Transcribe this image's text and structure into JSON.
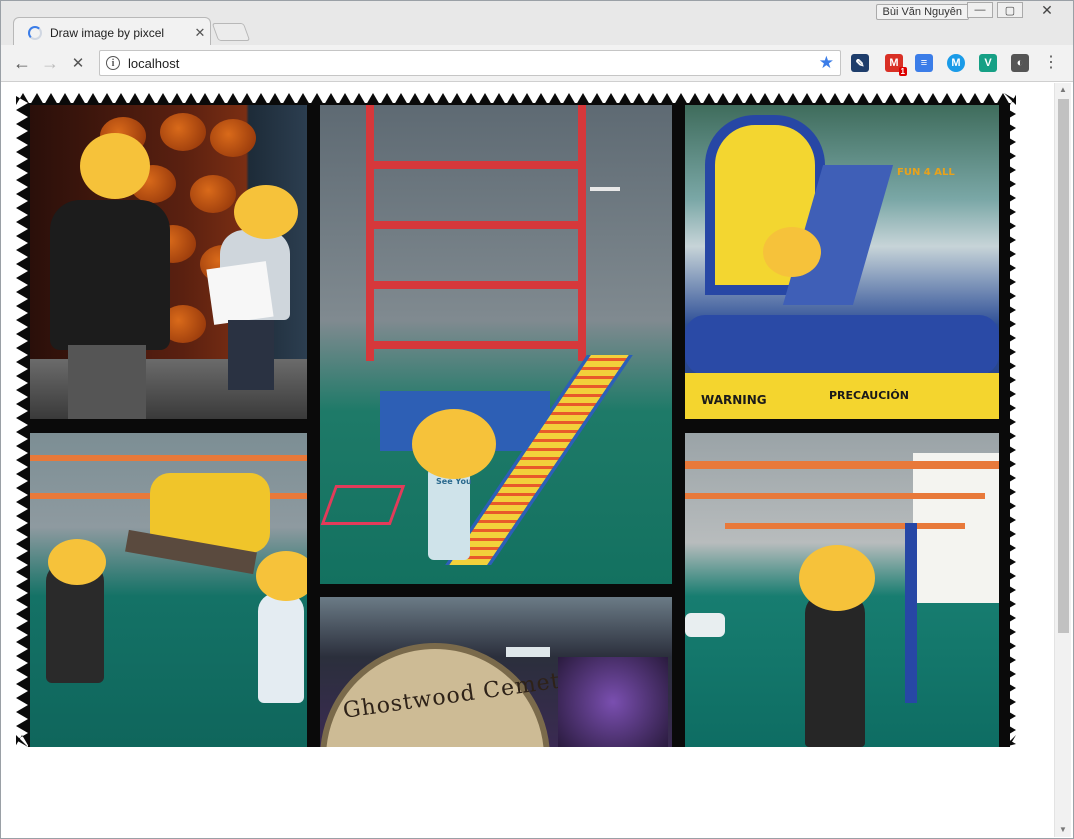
{
  "window": {
    "user_name": "Bùi Văn Nguyên",
    "minimize_icon": "minimize-icon",
    "maximize_icon": "maximize-icon",
    "close_glyph": "✕"
  },
  "tab": {
    "title": "Draw image by pixcel",
    "close_glyph": "✕",
    "loading": true
  },
  "toolbar": {
    "back_glyph": "←",
    "forward_glyph": "→",
    "stop_glyph": "✕",
    "url": "localhost",
    "star_glyph": "★",
    "extensions": [
      {
        "name": "eyedropper-extension-icon",
        "glyph": "✎",
        "color": "#1e3d6b"
      },
      {
        "name": "gmail-extension-icon",
        "glyph": "M",
        "color": "#d93025",
        "badge": "1"
      },
      {
        "name": "docs-extension-icon",
        "glyph": "≡",
        "color": "#3b7de8"
      },
      {
        "name": "m-extension-icon",
        "glyph": "M",
        "color": "#1a9be8"
      },
      {
        "name": "v-extension-icon",
        "glyph": "V",
        "color": "#16a085"
      },
      {
        "name": "lightbulb-extension-icon",
        "glyph": "◐",
        "color": "#555555"
      }
    ],
    "menu_glyph": "⋮"
  },
  "page": {
    "photos": [
      {
        "name": "photo-pumpkin-wall"
      },
      {
        "name": "photo-playground-tower"
      },
      {
        "name": "photo-bounce-house"
      },
      {
        "name": "photo-see-saw"
      },
      {
        "name": "photo-ghostwood-cemetery"
      },
      {
        "name": "photo-playground-right"
      }
    ],
    "sign_warning": "WARNING",
    "sign_precaucion": "PRECAUCIÓN",
    "fun_sign": "FUN 4 ALL",
    "shirt_text": "See You",
    "ghostwood_sign": "Ghostwood Cemetery"
  },
  "colors": {
    "emoji_yellow": "#f6c23a",
    "frame_black": "#0a0a0a"
  }
}
